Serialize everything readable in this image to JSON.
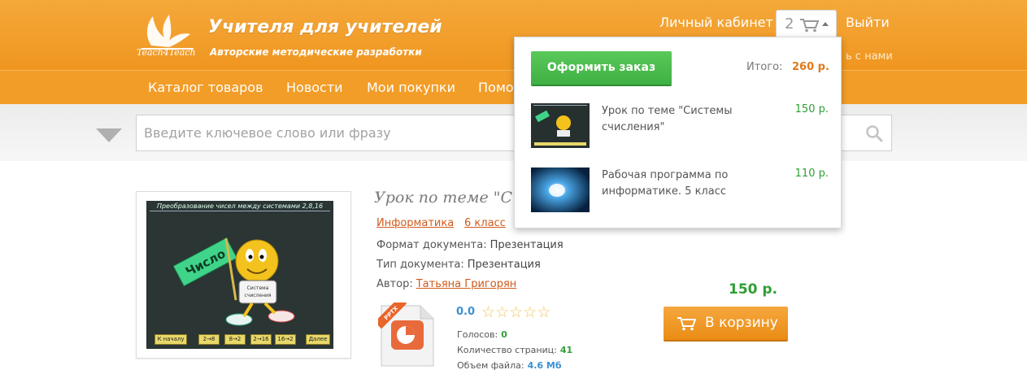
{
  "header": {
    "logo_text": "Teach4Teach",
    "title": "Учителя для учителей",
    "subtitle": "Авторские методические разработки",
    "account_link": "Личный кабинет",
    "cart_count": "2",
    "logout_link": "Выйти",
    "contact_partial": "ь с нами"
  },
  "nav": {
    "items": [
      "Каталог товаров",
      "Новости",
      "Мои покупки",
      "Помо"
    ]
  },
  "search": {
    "placeholder": "Введите ключевое слово или фразу"
  },
  "product": {
    "title": "Урок по теме \"С",
    "slide_title": "Преобразование чисел между системами 2,8,16",
    "slide_flag": "Число",
    "slide_badge": "Система счисления",
    "slide_buttons": [
      "К началу",
      "2→8",
      "8→2",
      "2→16",
      "16→2",
      "Далее"
    ],
    "tags": [
      "Информатика",
      "6 класс"
    ],
    "format_label": "Формат документа:",
    "format_value": "Презентация",
    "type_label": "Тип документа:",
    "type_value": "Презентация",
    "author_label": "Автор:",
    "author_value": "Татьяна Григорян",
    "file_badge": "PPTX",
    "rating": "0.0",
    "stars_filled": 0,
    "stars_total": 5,
    "votes_label": "Голосов:",
    "votes_value": "0",
    "pages_label": "Количество страниц:",
    "pages_value": "41",
    "size_label": "Объем файла:",
    "size_value": "4.6 Мб",
    "price": "150 р.",
    "add_to_cart": "В корзину"
  },
  "cart_dropdown": {
    "checkout_label": "Оформить заказ",
    "total_label": "Итого:",
    "total_value": "260 р.",
    "items": [
      {
        "name": "Урок по теме \"Системы счисления\"",
        "price": "150 р."
      },
      {
        "name": "Рабочая программа по информатике. 5 класс",
        "price": "110 р."
      }
    ]
  },
  "colors": {
    "header_orange": "#ef9620",
    "nav_orange": "#f29d28",
    "link_orange": "#d05a1c",
    "price_green": "#2f9e35",
    "checkout_green": "#3fb043"
  }
}
